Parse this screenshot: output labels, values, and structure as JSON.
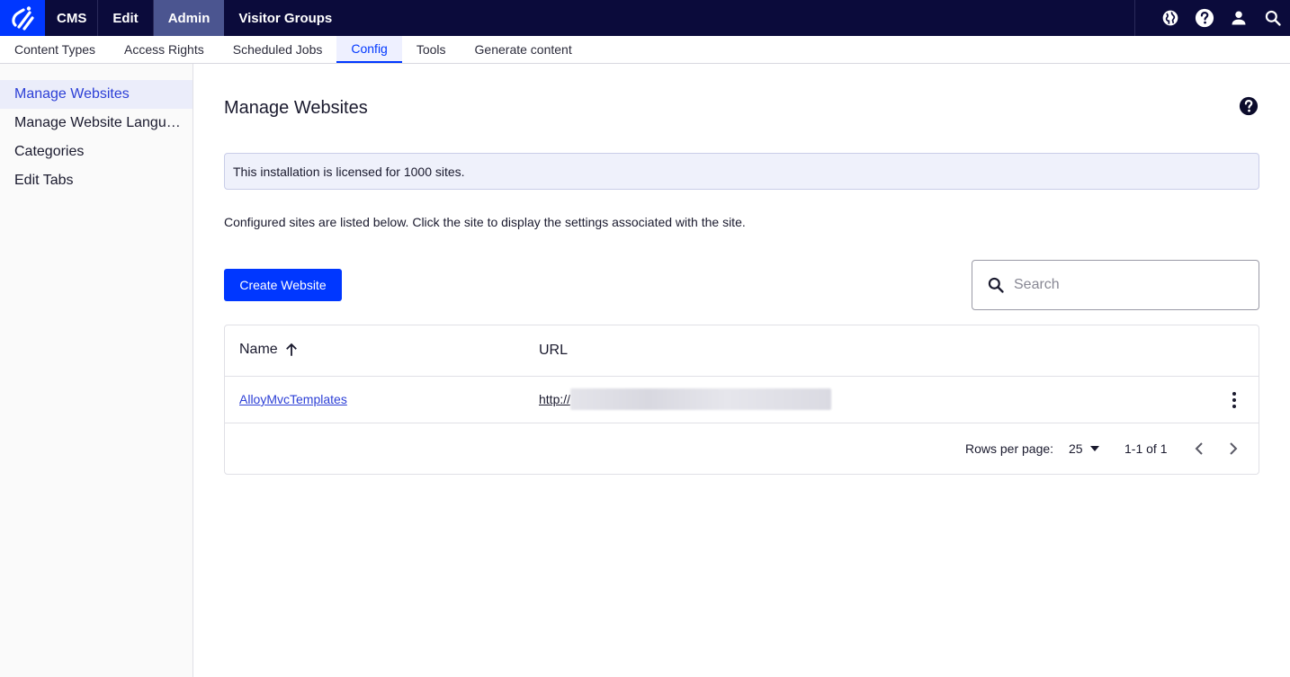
{
  "topbar": {
    "logo_icon": "optimizely-logo-icon",
    "nav": [
      {
        "label": "CMS"
      },
      {
        "label": "Edit"
      },
      {
        "label": "Admin"
      },
      {
        "label": "Visitor Groups"
      }
    ],
    "active_nav": "Admin",
    "icons": [
      "globe-icon",
      "help-icon",
      "user-icon",
      "search-icon"
    ]
  },
  "subnav": {
    "items": [
      {
        "label": "Content Types"
      },
      {
        "label": "Access Rights"
      },
      {
        "label": "Scheduled Jobs"
      },
      {
        "label": "Config"
      },
      {
        "label": "Tools"
      },
      {
        "label": "Generate content"
      }
    ],
    "active": "Config"
  },
  "sidebar": {
    "items": [
      {
        "label": "Manage Websites"
      },
      {
        "label": "Manage Website Languages"
      },
      {
        "label": "Categories"
      },
      {
        "label": "Edit Tabs"
      }
    ],
    "active": "Manage Websites"
  },
  "main": {
    "title": "Manage Websites",
    "license_notice": "This installation is licensed for 1000 sites.",
    "description": "Configured sites are listed below. Click the site to display the settings associated with the site.",
    "create_button": "Create Website",
    "search": {
      "placeholder": "Search",
      "value": ""
    },
    "table": {
      "columns": {
        "name": "Name",
        "url": "URL"
      },
      "sort": {
        "column": "Name",
        "direction": "ascending"
      },
      "rows": [
        {
          "name": "AlloyMvcTemplates",
          "url_protocol": "http://"
        }
      ],
      "footer": {
        "rows_per_page_label": "Rows per page:",
        "rows_per_page": "25",
        "range": "1-1 of 1"
      }
    }
  },
  "colors": {
    "topbar_bg": "#0b0b3b",
    "accent": "#0037ff",
    "active_nav_bg": "#4b5590",
    "link": "#2c3fd6"
  }
}
